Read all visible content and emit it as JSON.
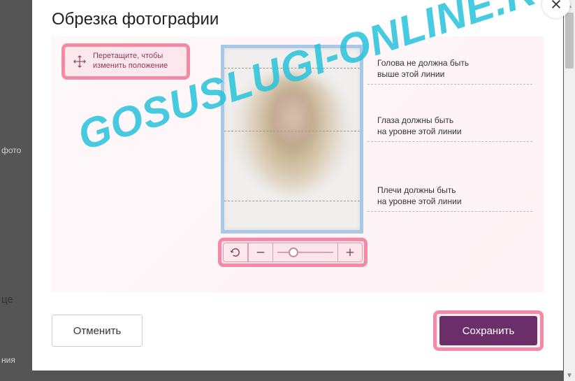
{
  "modal": {
    "title": "Обрезка фотографии",
    "drag_hint": "Перетащите, чтобы изменить положение",
    "guides": {
      "head": "Голова не должна быть\nвыше этой линии",
      "eyes": "Глаза должны быть\nна уровне этой линии",
      "shoulders": "Плечи должны быть\nна уровне этой линии"
    },
    "buttons": {
      "cancel": "Отменить",
      "save": "Сохранить"
    }
  },
  "watermark": "GOSUSLUGI-ONLINE.RU",
  "background": {
    "frag1": "фото",
    "frag2": "це",
    "frag3": "ния"
  }
}
